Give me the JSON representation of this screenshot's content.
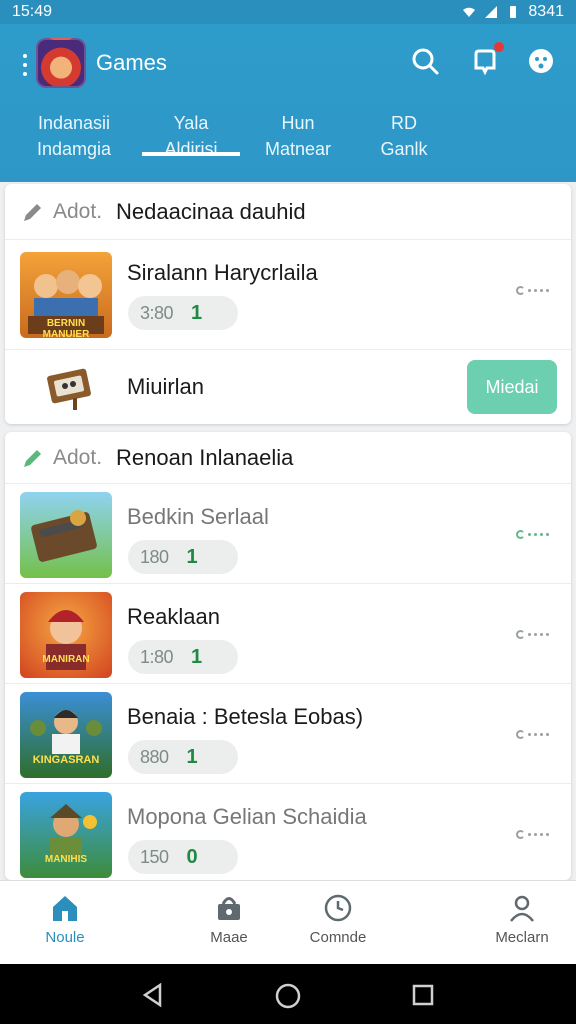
{
  "status": {
    "time": "15:49",
    "right_text": "8341"
  },
  "appbar": {
    "title": "Games"
  },
  "tabs": [
    {
      "line1": "Indanasii",
      "line2": "Indamgia"
    },
    {
      "line1": "Yala",
      "line2": "Aldirisi"
    },
    {
      "line1": "Hun",
      "line2": "Matnear"
    },
    {
      "line1": "RD",
      "line2": "Ganlk"
    }
  ],
  "section1": {
    "tag": "Adot.",
    "title": "Nedaacinaa dauhid",
    "items": [
      {
        "title": "Siralann Harycrlaila",
        "value": "3:80",
        "count": "1",
        "thumb_label": "BERNIN MANUIER"
      }
    ],
    "simple_item": {
      "title": "Miuirlan",
      "button": "Miedai"
    }
  },
  "section2": {
    "tag": "Adot.",
    "title": "Renoan Inlanaelia",
    "items": [
      {
        "title": "Bedkin Serlaal",
        "value": "180",
        "count": "1",
        "muted": true,
        "thumb_label": ""
      },
      {
        "title": "Reaklaan",
        "value": "1:80",
        "count": "1",
        "muted": false,
        "thumb_label": "MANIRAN"
      },
      {
        "title": "Benaia : Betesla Eobas)",
        "value": "880",
        "count": "1",
        "muted": false,
        "thumb_label": "KINGASRAN"
      },
      {
        "title": "Mopona Gelian Schaidia",
        "value": "150",
        "count": "0",
        "muted": true,
        "thumb_label": "MANIHIS"
      }
    ]
  },
  "bottom_nav": [
    {
      "label": "Noule",
      "icon": "home-icon"
    },
    {
      "label": "Maae",
      "icon": "store-icon"
    },
    {
      "label": "Comnde",
      "icon": "clock-icon"
    },
    {
      "label": "Meclarn",
      "icon": "person-icon"
    }
  ],
  "colors": {
    "primary": "#2e9ccb",
    "accent_green": "#6ccfaf",
    "count_green": "#1e8a44"
  }
}
